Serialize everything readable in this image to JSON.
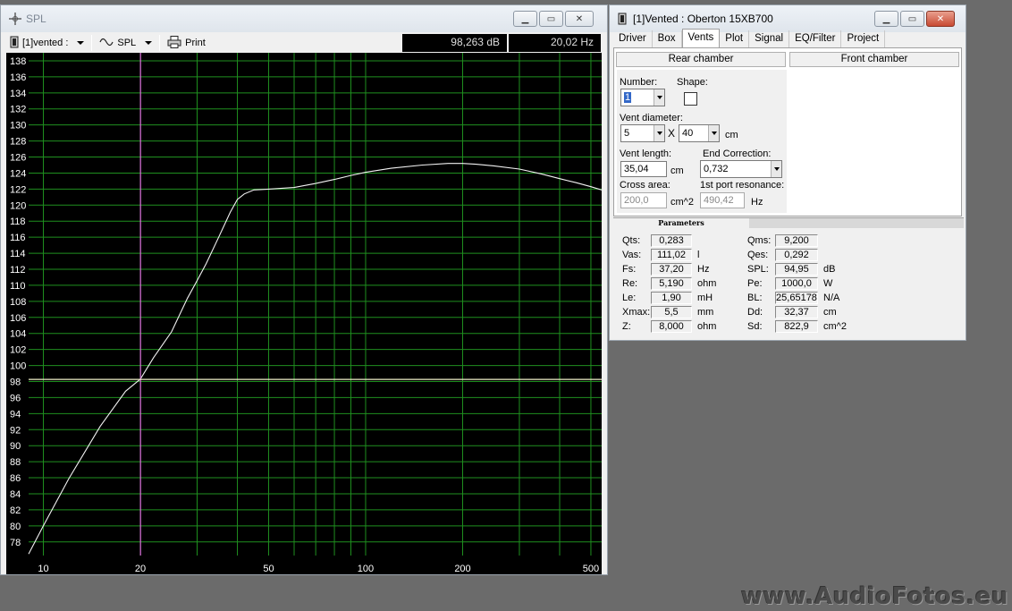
{
  "spl_window": {
    "title": "SPL",
    "toolbar": {
      "project_label": "[1]vented :",
      "curve_label": "SPL",
      "print_label": "Print"
    },
    "readout": {
      "db": "98,263 dB",
      "hz": "20,02 Hz"
    }
  },
  "vented_window": {
    "title": "[1]Vented : Oberton 15XB700",
    "tabs": [
      "Driver",
      "Box",
      "Vents",
      "Plot",
      "Signal",
      "EQ/Filter",
      "Project"
    ],
    "active_tab": "Vents",
    "chamber_buttons": {
      "rear": "Rear chamber",
      "front": "Front chamber"
    },
    "fields": {
      "number_label": "Number:",
      "number_value": "1",
      "shape_label": "Shape:",
      "vent_diameter_label": "Vent diameter:",
      "vent_diameter_a": "5",
      "times_sign": "X",
      "vent_diameter_b": "40",
      "vent_diameter_unit": "cm",
      "vent_length_label": "Vent length:",
      "vent_length_value": "35,04",
      "vent_length_unit": "cm",
      "end_correction_label": "End Correction:",
      "end_correction_value": "0,732",
      "cross_area_label": "Cross area:",
      "cross_area_value": "200,0",
      "cross_area_unit": "cm^2",
      "port_resonance_label": "1st port resonance:",
      "port_resonance_value": "490,42",
      "port_resonance_unit": "Hz"
    },
    "parameters_tab": "Parameters",
    "parameters_left": [
      {
        "name": "Qts:",
        "value": "0,283",
        "unit": ""
      },
      {
        "name": "Vas:",
        "value": "111,02",
        "unit": "l"
      },
      {
        "name": "Fs:",
        "value": "37,20",
        "unit": "Hz"
      },
      {
        "name": "Re:",
        "value": "5,190",
        "unit": "ohm"
      },
      {
        "name": "Le:",
        "value": "1,90",
        "unit": "mH"
      },
      {
        "name": "Xmax:",
        "value": "5,5",
        "unit": "mm"
      },
      {
        "name": "Z:",
        "value": "8,000",
        "unit": "ohm"
      }
    ],
    "parameters_right": [
      {
        "name": "Qms:",
        "value": "9,200",
        "unit": ""
      },
      {
        "name": "Qes:",
        "value": "0,292",
        "unit": ""
      },
      {
        "name": "SPL:",
        "value": "94,95",
        "unit": "dB"
      },
      {
        "name": "Pe:",
        "value": "1000,0",
        "unit": "W"
      },
      {
        "name": "BL:",
        "value": "25,65178",
        "unit": "N/A"
      },
      {
        "name": "Dd:",
        "value": "32,37",
        "unit": "cm"
      },
      {
        "name": "Sd:",
        "value": "822,9",
        "unit": "cm^2"
      }
    ]
  },
  "watermark": "www.AudioFotos.eu",
  "colors": {
    "grid": "#1f8f1f",
    "curve": "#f2f2f2",
    "cursor": "#e070e0",
    "plot_bg": "#000000"
  },
  "chart_data": {
    "type": "line",
    "x_scale": "log",
    "xlim": [
      9,
      540
    ],
    "ylim": [
      76.3,
      139
    ],
    "x_tick_labels": [
      "10",
      "20",
      "50",
      "100",
      "200",
      "500"
    ],
    "x_tick_values": [
      10,
      20,
      50,
      100,
      200,
      500
    ],
    "y_tick_values": [
      78,
      80,
      82,
      84,
      86,
      88,
      90,
      92,
      94,
      96,
      98,
      100,
      102,
      104,
      106,
      108,
      110,
      112,
      114,
      116,
      118,
      120,
      122,
      124,
      126,
      128,
      130,
      132,
      134,
      136,
      138
    ],
    "grid": true,
    "cursor": {
      "x": 20.02,
      "y": 98.263
    },
    "series": [
      {
        "x": [
          9,
          10,
          12,
          15,
          18,
          20,
          22,
          25,
          28,
          30,
          32,
          35,
          38,
          40,
          42,
          45,
          50,
          60,
          70,
          80,
          90,
          100,
          120,
          150,
          180,
          200,
          220,
          250,
          300,
          350,
          400,
          450,
          500,
          540
        ],
        "y": [
          76.5,
          80.0,
          85.9,
          92.4,
          96.8,
          98.3,
          101.0,
          104.2,
          108.4,
          110.6,
          112.7,
          116.0,
          119.1,
          120.7,
          121.4,
          121.9,
          122.0,
          122.2,
          122.7,
          123.2,
          123.7,
          124.1,
          124.6,
          125.0,
          125.2,
          125.2,
          125.1,
          124.9,
          124.5,
          123.9,
          123.3,
          122.8,
          122.3,
          121.9
        ]
      }
    ]
  }
}
